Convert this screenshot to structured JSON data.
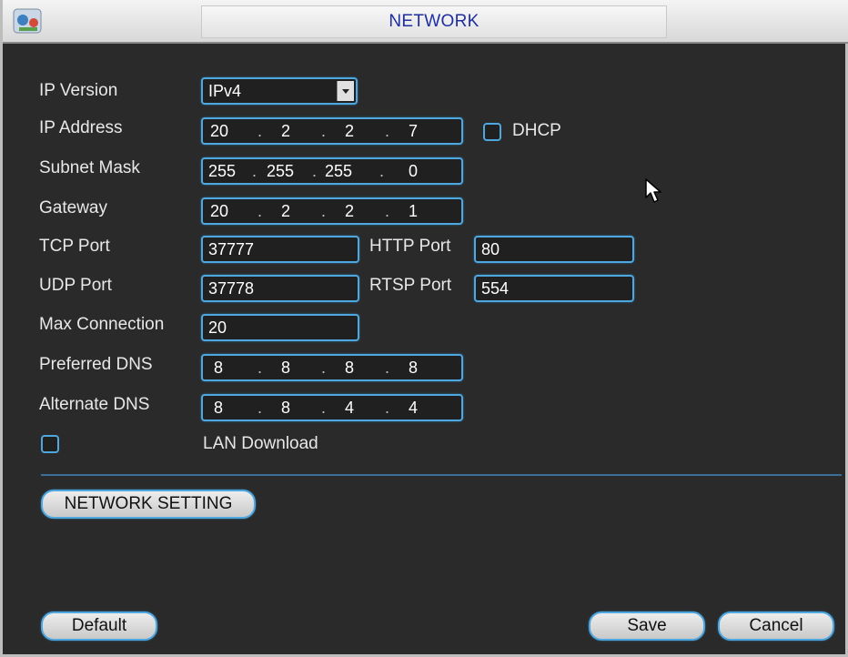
{
  "window": {
    "title": "NETWORK"
  },
  "form": {
    "ip_version": {
      "label": "IP Version",
      "value": "IPv4"
    },
    "ip_address": {
      "label": "IP Address",
      "octets": [
        "20",
        "2",
        "2",
        "7"
      ]
    },
    "dhcp": {
      "label": "DHCP",
      "checked": false
    },
    "subnet_mask": {
      "label": "Subnet Mask",
      "octets": [
        "255",
        "255",
        "255",
        "0"
      ]
    },
    "gateway": {
      "label": "Gateway",
      "octets": [
        "20",
        "2",
        "2",
        "1"
      ]
    },
    "tcp_port": {
      "label": "TCP Port",
      "value": "37777"
    },
    "http_port": {
      "label": "HTTP Port",
      "value": "80"
    },
    "udp_port": {
      "label": "UDP Port",
      "value": "37778"
    },
    "rtsp_port": {
      "label": "RTSP Port",
      "value": "554"
    },
    "max_connection": {
      "label": "Max Connection",
      "value": "20"
    },
    "preferred_dns": {
      "label": "Preferred DNS",
      "octets": [
        "8",
        "8",
        "8",
        "8"
      ]
    },
    "alternate_dns": {
      "label": "Alternate DNS",
      "octets": [
        "8",
        "8",
        "4",
        "4"
      ]
    },
    "lan_download": {
      "label": "LAN Download",
      "checked": false
    }
  },
  "buttons": {
    "network_setting": "NETWORK SETTING",
    "default": "Default",
    "save": "Save",
    "cancel": "Cancel"
  },
  "colors": {
    "accent_border": "#4fa7e0",
    "title_text": "#1f2fa0",
    "panel_bg": "#2a2a2a"
  }
}
